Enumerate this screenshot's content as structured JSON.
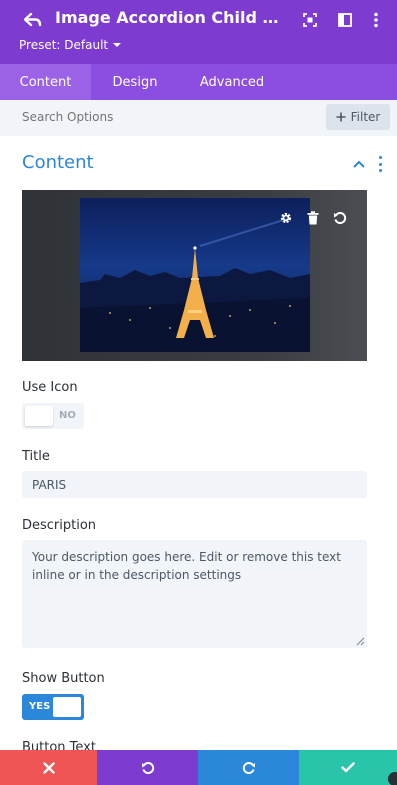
{
  "header": {
    "title": "Image Accordion Child Settings",
    "preset_label": "Preset: Default",
    "icons": [
      "back-arrow-icon",
      "expand-icon",
      "sidebar-layout-icon",
      "more-vertical-icon"
    ],
    "background": "#7e3bd0"
  },
  "tabs": [
    {
      "label": "Content",
      "active": true
    },
    {
      "label": "Design",
      "active": false
    },
    {
      "label": "Advanced",
      "active": false
    }
  ],
  "search": {
    "placeholder": "Search Options",
    "filter_label": "Filter"
  },
  "section": {
    "title": "Content"
  },
  "image_controls": [
    "gear-icon",
    "trash-icon",
    "reset-icon"
  ],
  "fields": {
    "use_icon": {
      "label": "Use Icon",
      "value": "NO"
    },
    "title": {
      "label": "Title",
      "value": "PARIS"
    },
    "description": {
      "label": "Description",
      "value": "Your description goes here. Edit or remove this text inline or in the description settings"
    },
    "show_button": {
      "label": "Show Button",
      "value": "YES"
    },
    "button_text": {
      "label": "Button Text"
    }
  },
  "bottom_bar": {
    "buttons": [
      "close-icon",
      "undo-icon",
      "redo-icon",
      "check-icon"
    ],
    "colors": [
      "#ef5555",
      "#7e3bd0",
      "#2b87da",
      "#29c4a9"
    ]
  },
  "accent_color": "#2b87da"
}
